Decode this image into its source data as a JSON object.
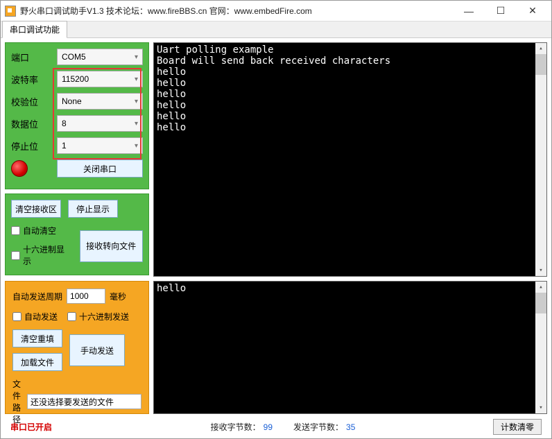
{
  "window": {
    "title": "野火串口调试助手V1.3    技术论坛：www.fireBBS.cn    官网：www.embedFire.com"
  },
  "tab": {
    "label": "串口调试功能"
  },
  "port": {
    "labels": {
      "port": "端口",
      "baud": "波特率",
      "parity": "校验位",
      "data": "数据位",
      "stop": "停止位"
    },
    "values": {
      "port": "COM5",
      "baud": "115200",
      "parity": "None",
      "data": "8",
      "stop": "1"
    },
    "close_btn": "关闭串口"
  },
  "rx": {
    "clear_btn": "清空接收区",
    "stop_btn": "停止显示",
    "auto_clear": "自动清空",
    "hex_display": "十六进制显示",
    "to_file": "接收转向文件"
  },
  "tx": {
    "period_label": "自动发送周期",
    "period_value": "1000",
    "period_unit": "毫秒",
    "auto_send": "自动发送",
    "hex_send": "十六进制发送",
    "clear_fill": "清空重填",
    "load_file": "加载文件",
    "manual_send": "手动发送",
    "path_label": "文件路径",
    "path_value": "还没选择要发送的文件"
  },
  "console_rx": "Uart polling example\nBoard will send back received characters\nhello\nhello\nhello\nhello\nhello\nhello",
  "console_tx": "hello",
  "status": {
    "open": "串口已开启",
    "rx_label": "接收字节数：",
    "rx_val": "99",
    "tx_label": "发送字节数：",
    "tx_val": "35",
    "reset": "计数清零"
  }
}
